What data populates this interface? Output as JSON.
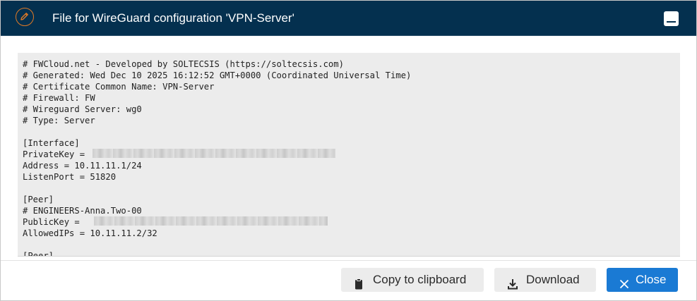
{
  "dialog": {
    "title": "File for WireGuard configuration 'VPN-Server'",
    "icons": {
      "edit": "pencil-icon",
      "minimize": "minimize-icon",
      "copy": "clipboard-icon",
      "download": "download-icon",
      "close": "close-icon"
    },
    "colors": {
      "header_bg": "#04304f",
      "accent_orange": "#e07a26",
      "primary_button": "#1a7ad4",
      "code_bg": "#ececec"
    }
  },
  "config": {
    "lines": [
      "# FWCloud.net - Developed by SOLTECSIS (https://soltecsis.com)",
      "# Generated: Wed Dec 10 2025 16:12:52 GMT+0000 (Coordinated Universal Time)",
      "# Certificate Common Name: VPN-Server",
      "# Firewall: FW",
      "# Wireguard Server: wg0",
      "# Type: Server",
      "",
      "[Interface]",
      "PrivateKey = ",
      "Address = 10.11.11.1/24",
      "ListenPort = 51820",
      "",
      "[Peer]",
      "# ENGINEERS-Anna.Two-00",
      "PublicKey =",
      "AllowedIPs = 10.11.11.2/32",
      "",
      "[Peer]"
    ]
  },
  "footer": {
    "copy_label": "Copy to clipboard",
    "download_label": "Download",
    "close_label": "Close"
  }
}
